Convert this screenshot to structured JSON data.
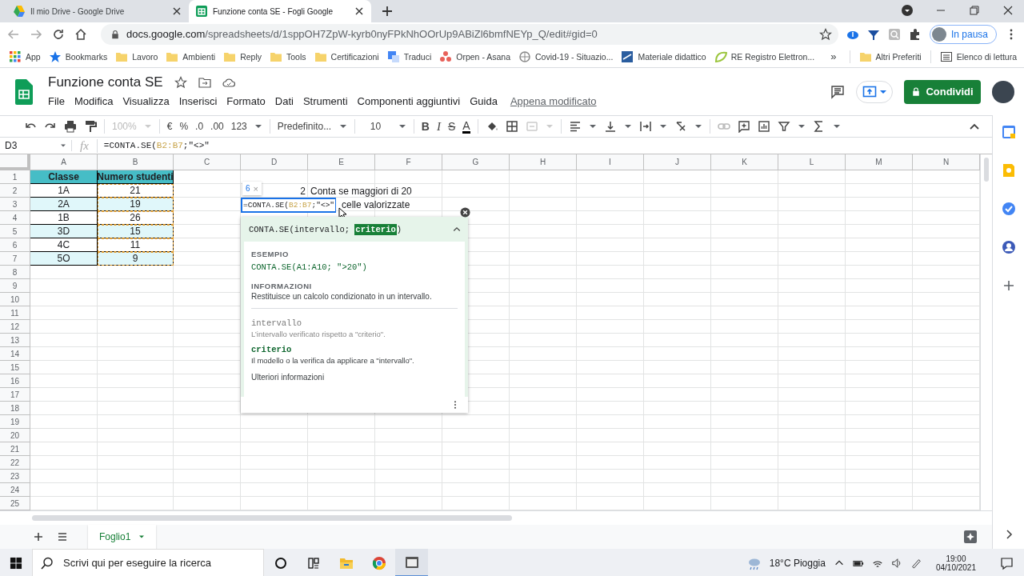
{
  "browser": {
    "tabs": [
      {
        "kind": "drive",
        "title": "Il mio Drive - Google Drive",
        "selected": false
      },
      {
        "kind": "sheets",
        "title": "Funzione conta SE - Fogli Google",
        "selected": true
      }
    ],
    "url_domain": "docs.google.com",
    "url_path": "/spreadsheets/d/1sppOH7ZpW-kyrb0nyFPkNhOOrUp9ABiZl6bmfNEYp_Q/edit#gid=0",
    "profile": "In pausa",
    "bookmarks": [
      {
        "kind": "apps",
        "label": "App"
      },
      {
        "kind": "star",
        "label": "Bookmarks"
      },
      {
        "kind": "folder",
        "label": "Lavoro"
      },
      {
        "kind": "folder",
        "label": "Ambienti"
      },
      {
        "kind": "folder",
        "label": "Reply"
      },
      {
        "kind": "folder",
        "label": "Tools"
      },
      {
        "kind": "folder",
        "label": "Certificazioni"
      },
      {
        "kind": "translate",
        "label": "Traduci"
      },
      {
        "kind": "dots",
        "label": "Orpen - Asana"
      },
      {
        "kind": "globe",
        "label": "Covid-19 - Situazio..."
      },
      {
        "kind": "board",
        "label": "Materiale didattico"
      },
      {
        "kind": "re",
        "label": "RE Registro Elettron..."
      }
    ],
    "overflow": "»",
    "bookmarks_right": [
      {
        "kind": "folder",
        "label": "Altri Preferiti"
      },
      {
        "kind": "list",
        "label": "Elenco di lettura"
      }
    ]
  },
  "doc": {
    "title": "Funzione conta SE",
    "menus": [
      "File",
      "Modifica",
      "Visualizza",
      "Inserisci",
      "Formato",
      "Dati",
      "Strumenti",
      "Componenti aggiuntivi",
      "Guida"
    ],
    "last_edit": "Appena modificato",
    "share": "Condividi"
  },
  "toolbar": {
    "zoom": "100%",
    "currency": "€",
    "percent": "%",
    "dec_less": ".0",
    "dec_more": ".00",
    "format": "123",
    "font": "Predefinito...",
    "size": "10",
    "bold": "B",
    "italic": "I",
    "strike": "S",
    "text_color": "A"
  },
  "formula_bar": {
    "cell": "D3",
    "fx": "fx",
    "formula": {
      "prefix": "=CONTA.SE(",
      "range": "B2:B7",
      "suffix": ";\"<>\""
    }
  },
  "grid": {
    "columns": [
      "A",
      "B",
      "C",
      "D",
      "E",
      "F",
      "G",
      "H",
      "I",
      "J",
      "K",
      "L",
      "M",
      "N"
    ],
    "row_numbers": [
      "1",
      "2",
      "3",
      "4",
      "5",
      "6",
      "7",
      "8",
      "9",
      "10",
      "11",
      "12",
      "13",
      "14",
      "15",
      "16",
      "17",
      "18",
      "19",
      "20",
      "21",
      "22",
      "23",
      "24",
      "25"
    ],
    "table": {
      "header": [
        "Classe",
        "Numero studenti"
      ],
      "rows": [
        [
          "1A",
          "21"
        ],
        [
          "2A",
          "19"
        ],
        [
          "1B",
          "26"
        ],
        [
          "3D",
          "15"
        ],
        [
          "4C",
          "11"
        ],
        [
          "5O",
          "9"
        ]
      ]
    },
    "notes": [
      {
        "value": "2",
        "label": "Conta se maggiori di 20"
      },
      {
        "label": "celle valorizzate"
      }
    ]
  },
  "editor": {
    "formula": {
      "prefix": "=CONTA.SE(",
      "range": "B2:B7",
      "suffix": ";\"<>\""
    },
    "hint_count": "6",
    "hint_close": "×"
  },
  "help": {
    "signature": {
      "before": "CONTA.SE(intervallo; ",
      "highlight": "criterio",
      "after": ")"
    },
    "example_label": "ESEMPIO",
    "example": "CONTA.SE(A1:A10; \">20\")",
    "info_label": "INFORMAZIONI",
    "info": "Restituisce un calcolo condizionato in un intervallo.",
    "params": [
      {
        "name": "intervallo",
        "selected": false,
        "text": "L’intervallo verificato rispetto a \"criterio\"."
      },
      {
        "name": "criterio",
        "selected": true,
        "text": "Il modello o la verifica da applicare a \"intervallo\"."
      }
    ],
    "more": "Ulteriori informazioni"
  },
  "sheets": [
    {
      "name": "Foglio1",
      "selected": true
    }
  ],
  "taskbar": {
    "search_placeholder": "Scrivi qui per eseguire la ricerca",
    "weather": "18°C Pioggia",
    "time": "19:00",
    "date": "04/10/2021"
  }
}
